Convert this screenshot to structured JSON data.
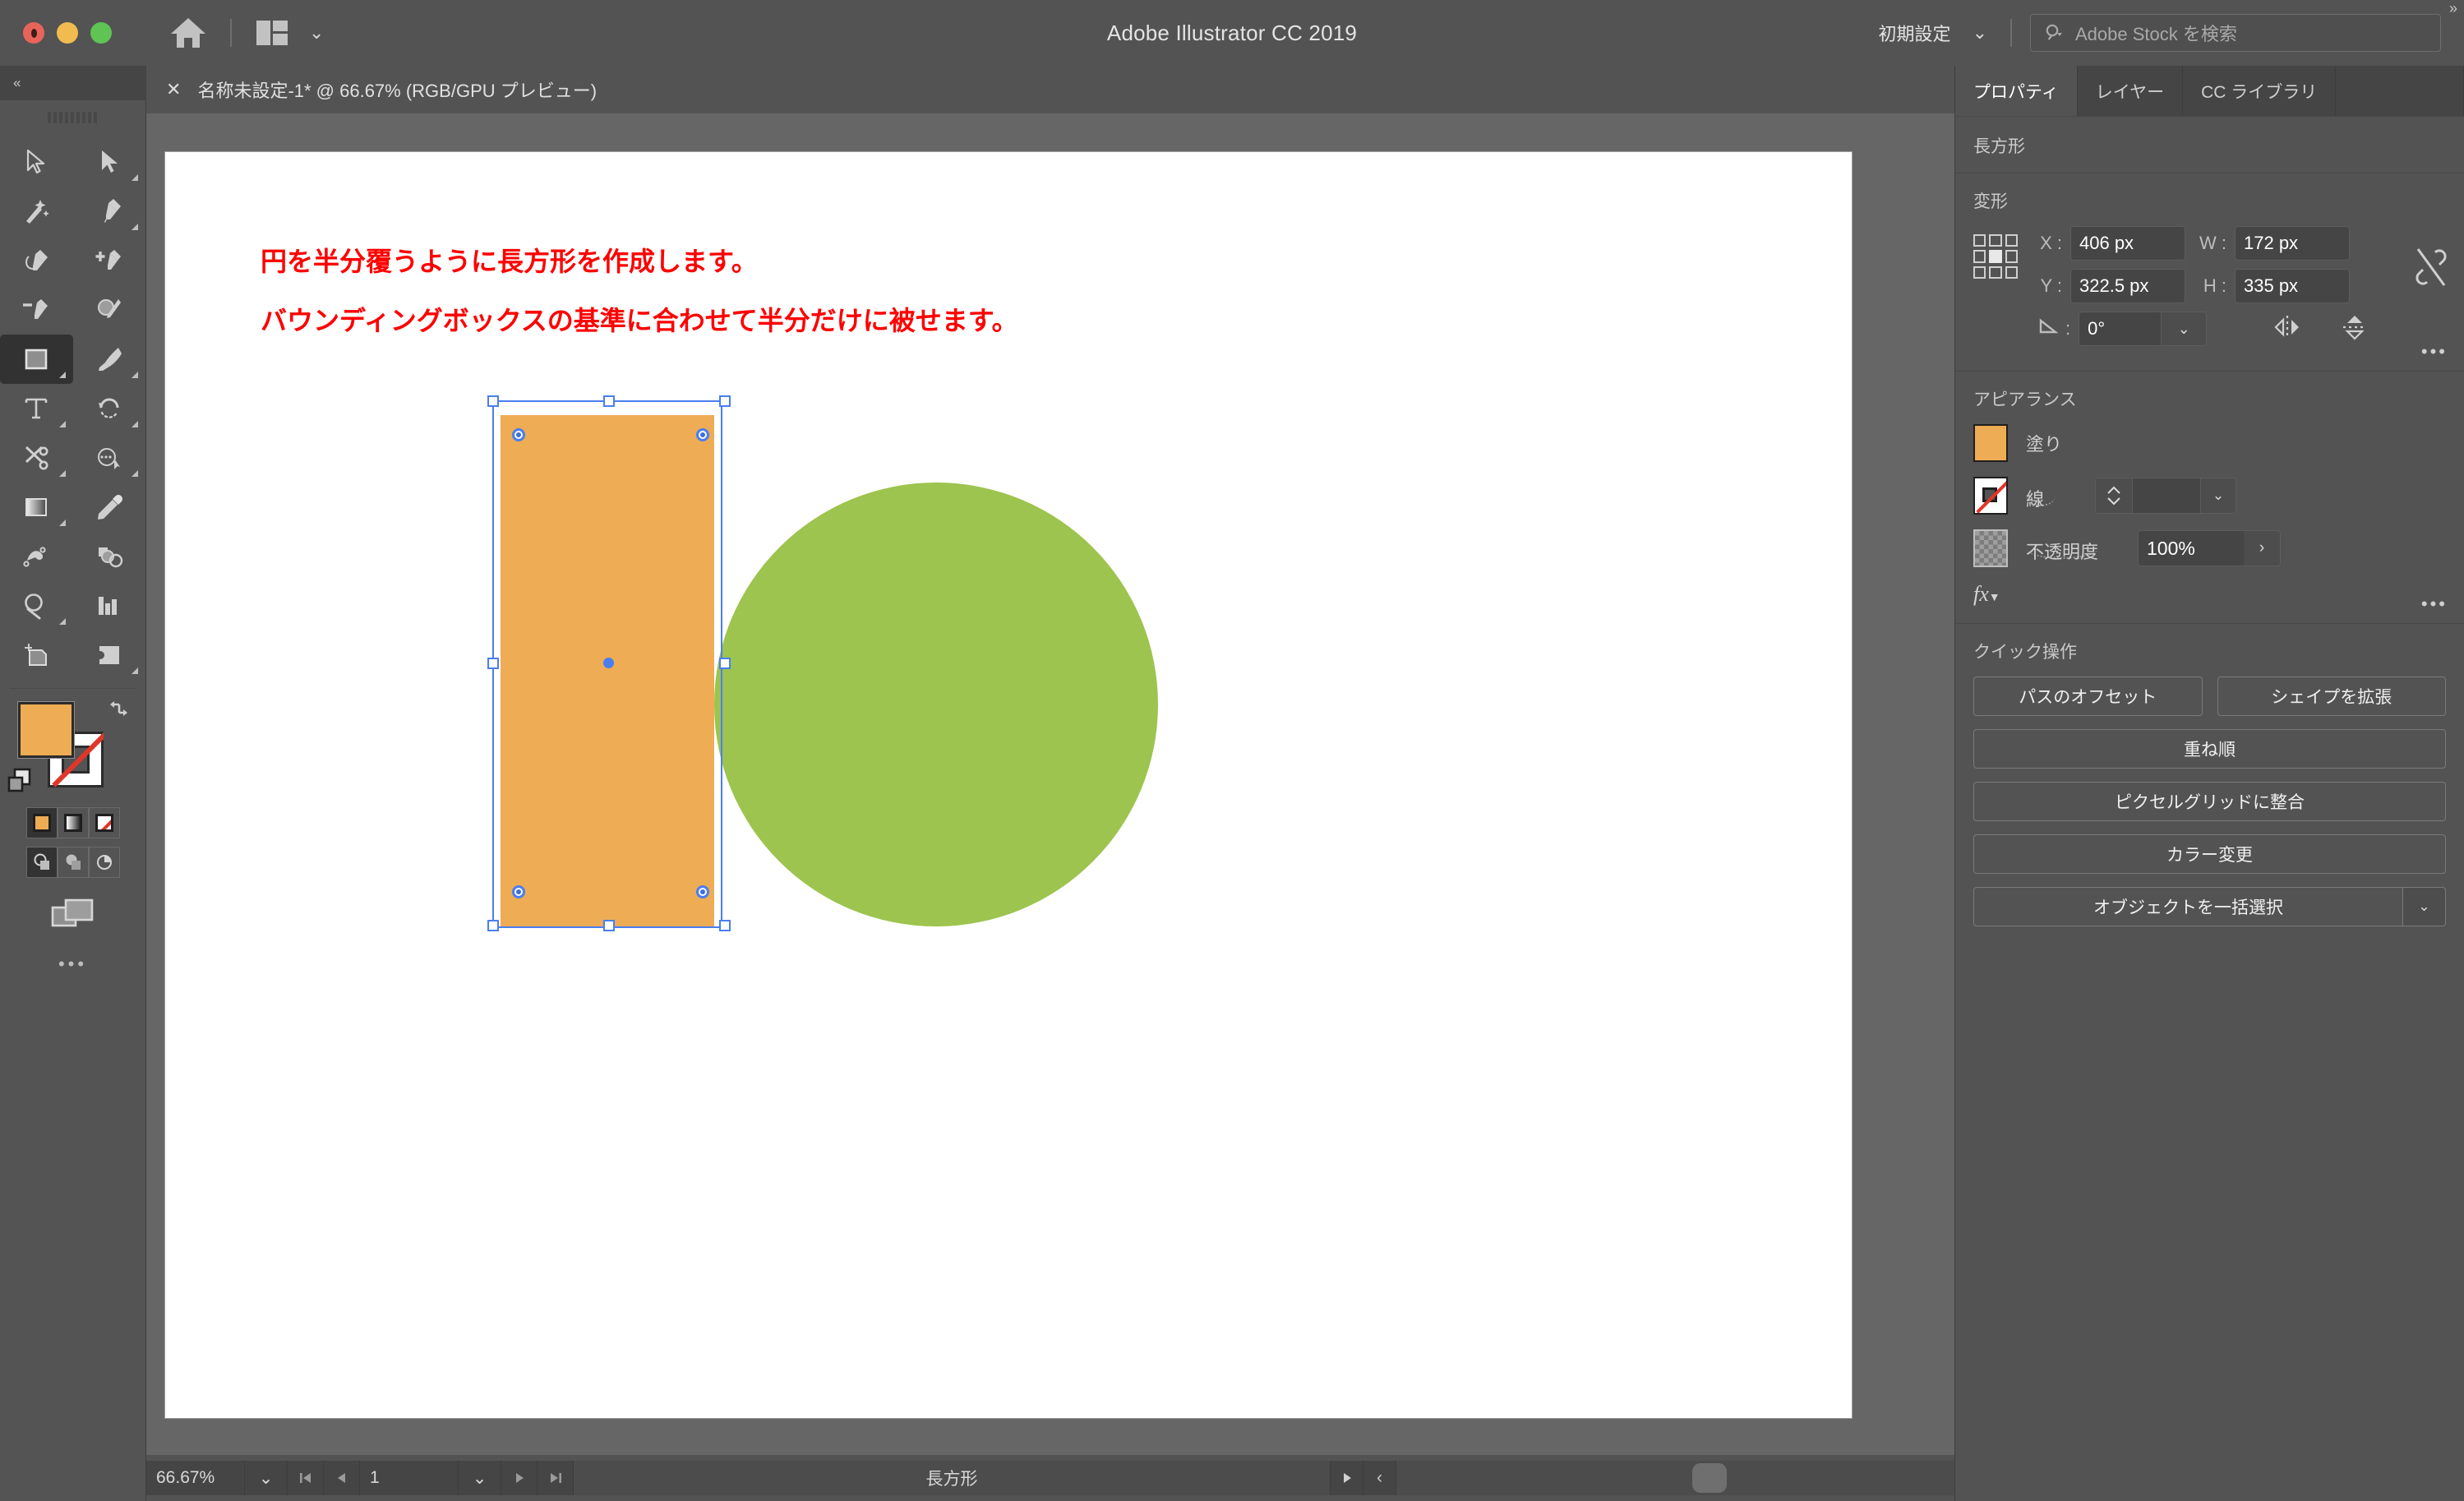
{
  "window": {
    "app_title": "Adobe Illustrator CC 2019",
    "traffic_lights": [
      "close",
      "minimize",
      "zoom"
    ],
    "home_icon": "home-icon",
    "layout_icon": "layout-switcher-icon",
    "layout_chevron": "⌄",
    "workspace_preset": "初期設定",
    "workspace_chevron": "⌄",
    "stock_search_placeholder": "Adobe Stock を検索",
    "expand_panel_glyph": "»",
    "collapse_panel_glyph": "«"
  },
  "document_tab": {
    "close_glyph": "✕",
    "title": "名称未設定-1* @ 66.67% (RGB/GPU プレビュー)"
  },
  "toolbar": {
    "tools": [
      {
        "name": "selection-tool",
        "label": "選択ツール",
        "flyout": false,
        "active": false
      },
      {
        "name": "direct-selection-tool",
        "label": "ダイレクト選択ツール",
        "flyout": true,
        "active": false
      },
      {
        "name": "magic-wand-tool",
        "label": "自動選択ツール",
        "flyout": false,
        "active": false
      },
      {
        "name": "pen-tool",
        "label": "ペンツール",
        "flyout": true,
        "active": false
      },
      {
        "name": "curvature-tool",
        "label": "曲線ツール",
        "flyout": false,
        "active": false
      },
      {
        "name": "add-anchor-point-tool",
        "label": "アンカーポイントの追加",
        "flyout": false,
        "active": false
      },
      {
        "name": "delete-anchor-point-tool",
        "label": "アンカーポイントの削除",
        "flyout": false,
        "active": false
      },
      {
        "name": "shaper-tool",
        "label": "Shaper ツール",
        "flyout": false,
        "active": false
      },
      {
        "name": "rectangle-tool",
        "label": "長方形ツール",
        "flyout": true,
        "active": true
      },
      {
        "name": "paintbrush-tool",
        "label": "ブラシツール",
        "flyout": true,
        "active": false
      },
      {
        "name": "type-tool",
        "label": "文字ツール",
        "flyout": true,
        "active": false
      },
      {
        "name": "rotate-tool",
        "label": "回転ツール",
        "flyout": true,
        "active": false
      },
      {
        "name": "scissors-tool",
        "label": "はさみツール",
        "flyout": true,
        "active": false
      },
      {
        "name": "width-tool",
        "label": "線幅ツール",
        "flyout": true,
        "active": false
      },
      {
        "name": "gradient-tool",
        "label": "グラデーションツール",
        "flyout": true,
        "active": false
      },
      {
        "name": "eyedropper-tool",
        "label": "スポイトツール",
        "flyout": false,
        "active": false
      },
      {
        "name": "blend-tool",
        "label": "ブレンドツール",
        "flyout": false,
        "active": false
      },
      {
        "name": "shape-builder-tool",
        "label": "シェイプ形成ツール",
        "flyout": false,
        "active": false
      },
      {
        "name": "zoom-tool",
        "label": "ズームツール",
        "flyout": true,
        "active": false
      },
      {
        "name": "graph-tool",
        "label": "グラフツール",
        "flyout": false,
        "active": false
      },
      {
        "name": "artboard-tool",
        "label": "アートボードツール",
        "flyout": false,
        "active": false
      },
      {
        "name": "slice-tool",
        "label": "スライスツール",
        "flyout": true,
        "active": false
      }
    ],
    "fill_color": "#eeac54",
    "stroke_color": "none",
    "swap_icon": "swap-fill-stroke-icon",
    "default_icon": "default-fill-stroke-icon",
    "paint_modes": [
      "fill-color-mode",
      "gradient-mode",
      "none-mode"
    ],
    "paint_mode_selected": 0,
    "draw_modes": [
      "draw-normal",
      "draw-behind",
      "draw-inside"
    ],
    "draw_mode_selected": 0,
    "screen_mode_icon": "screen-mode-icon",
    "more_tools_glyph": "•••"
  },
  "canvas": {
    "annotation_line_1": "円を半分覆うように長方形を作成します。",
    "annotation_line_2": "バウンディングボックスの基準に合わせて半分だけに被せます。",
    "annotation_color": "#fe0000",
    "shapes": [
      {
        "name": "green-circle",
        "type": "ellipse",
        "fill": "#9dc44e"
      },
      {
        "name": "orange-rectangle",
        "type": "rectangle",
        "fill": "#eeac54",
        "selected": true
      }
    ],
    "selection_color": "#4a7ef0"
  },
  "status_bar": {
    "zoom_level": "66.67%",
    "zoom_dropdown_glyph": "⌄",
    "first_page_glyph": "⏮",
    "prev_page_glyph": "◀",
    "page_number": "1",
    "page_dropdown_glyph": "⌄",
    "next_page_glyph": "▶",
    "last_page_glyph": "⏭",
    "status_text": "長方形",
    "play_glyph": "▶",
    "collapse_glyph": "‹",
    "hscroll_right_glyph": "›"
  },
  "right_panel": {
    "tabs": [
      {
        "name": "tab-properties",
        "label": "プロパティ",
        "active": true
      },
      {
        "name": "tab-layers",
        "label": "レイヤー",
        "active": false
      },
      {
        "name": "tab-cc-libraries",
        "label": "CC ライブラリ",
        "active": false
      }
    ],
    "object_type": "長方形",
    "transform": {
      "title": "変形",
      "reference_point_selected": "center",
      "x_label": "X :",
      "x_value": "406 px",
      "y_label": "Y :",
      "y_value": "322.5 px",
      "w_label": "W :",
      "w_value": "172 px",
      "h_label": "H :",
      "h_value": "335 px",
      "angle_label": "angle-icon",
      "angle_value": "0°",
      "angle_dropdown_glyph": "⌄",
      "link_icon": "unlink-proportions-icon",
      "flip_horizontal_icon": "flip-horizontal-icon",
      "flip_vertical_icon": "flip-vertical-icon",
      "more_options_glyph": "•••"
    },
    "appearance": {
      "title": "アピアランス",
      "fill_label": "塗り",
      "fill_color": "#eeac54",
      "stroke_label": "線",
      "stroke_color": "none",
      "stroke_weight": "",
      "stroke_dropdown_glyph": "⌄",
      "opacity_label": "不透明度",
      "opacity_value": "100%",
      "opacity_more_glyph": "›",
      "fx_label": "fx",
      "more_options_glyph": "•••"
    },
    "quick_actions": {
      "title": "クイック操作",
      "buttons": [
        {
          "name": "offset-path-button",
          "label": "パスのオフセット"
        },
        {
          "name": "expand-shape-button",
          "label": "シェイプを拡張"
        },
        {
          "name": "arrange-button",
          "label": "重ね順"
        },
        {
          "name": "align-to-pixel-grid-button",
          "label": "ピクセルグリッドに整合"
        },
        {
          "name": "recolor-button",
          "label": "カラー変更"
        }
      ],
      "select_all_objects": {
        "name": "select-similar-objects-button",
        "label": "オブジェクトを一括選択",
        "dropdown_glyph": "⌄"
      }
    }
  }
}
